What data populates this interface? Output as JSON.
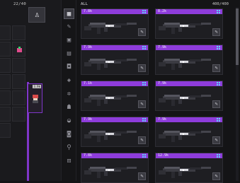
{
  "left": {
    "count": "22/40",
    "filter_icon": "person-silhouette-icon",
    "cells": [
      {
        "tag": "",
        "level": "",
        "sprite": "",
        "sel": false
      },
      {
        "tag": "",
        "level": "",
        "sprite": "",
        "sel": false
      },
      {
        "tag": "",
        "level": "",
        "sprite": "",
        "sel": false
      },
      {
        "tag": "",
        "level": "",
        "sprite": "pink-figure",
        "sel": false
      },
      {
        "tag": "",
        "level": "",
        "sprite": "",
        "sel": false
      },
      {
        "tag": "",
        "level": "",
        "sprite": "",
        "sel": false
      },
      {
        "tag": "",
        "level": "",
        "sprite": "",
        "sel": false
      },
      {
        "tag": "",
        "level": "",
        "sprite": "",
        "sel": false
      },
      {
        "tag": "",
        "level": "",
        "sprite": "",
        "sel": false
      },
      {
        "tag": "",
        "level": "",
        "sprite": "",
        "sel": false
      },
      {
        "tag": "",
        "level": "",
        "sprite": "",
        "sel": false
      },
      {
        "tag": "",
        "level": "",
        "sprite": "",
        "sel": false
      },
      {
        "tag": "",
        "level": "",
        "sprite": "",
        "sel": false
      }
    ],
    "highlight_tag": "3.9k"
  },
  "toolbar": {
    "items": [
      {
        "name": "grid-view-icon",
        "glyph": "▦",
        "active": true
      },
      {
        "name": "pencil-icon",
        "glyph": "✎",
        "active": false
      },
      {
        "name": "box-icon",
        "glyph": "▣",
        "active": false
      },
      {
        "name": "archive-icon",
        "glyph": "▤",
        "active": false
      },
      {
        "name": "camera-icon",
        "glyph": "◘",
        "active": false
      },
      {
        "name": "shield-icon",
        "glyph": "◈",
        "active": false
      },
      {
        "name": "gear-icon",
        "glyph": "✲",
        "active": false
      },
      {
        "name": "robot-icon",
        "glyph": "☗",
        "active": false
      },
      {
        "name": "cup-icon",
        "glyph": "◒",
        "active": false
      },
      {
        "name": "bag-icon",
        "glyph": "◙",
        "active": false
      },
      {
        "name": "key-icon",
        "glyph": "⚲",
        "active": false
      },
      {
        "name": "dice-icon",
        "glyph": "⚅",
        "active": false
      }
    ]
  },
  "main": {
    "title": "ALL",
    "count": "400/400",
    "cards": [
      {
        "price": "7.8k"
      },
      {
        "price": "8.2k"
      },
      {
        "price": "7.9k"
      },
      {
        "price": "7.9k"
      },
      {
        "price": "7.1k"
      },
      {
        "price": "7.9k"
      },
      {
        "price": "7.9k"
      },
      {
        "price": "7.9k"
      },
      {
        "price": "7.8k"
      },
      {
        "price": "12.9k"
      }
    ]
  },
  "colors": {
    "accent": "#8e3cdb",
    "badge": "#5fd0ff"
  }
}
